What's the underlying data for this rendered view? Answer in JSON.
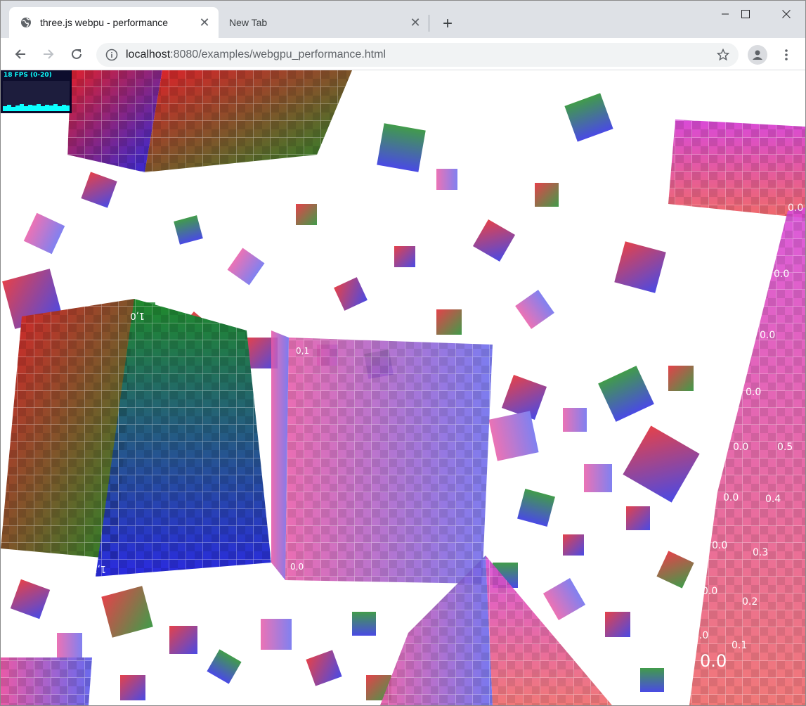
{
  "browser": {
    "tabs": [
      {
        "title": "three.js webpu - performance",
        "active": true
      },
      {
        "title": "New Tab",
        "active": false
      }
    ],
    "address": {
      "host": "localhost",
      "path": ":8080/examples/webgpu_performance.html"
    }
  },
  "stats": {
    "label": "18 FPS (0-20)"
  },
  "colors": {
    "accent_red": "#e0202a",
    "accent_green": "#1f8a2a",
    "accent_blue": "#2a2ae0",
    "accent_pink": "#e85aa8",
    "stats_text": "#00ffff"
  },
  "icons": [
    "globe-icon",
    "close-icon",
    "plus-icon",
    "back-arrow-icon",
    "forward-arrow-icon",
    "reload-icon",
    "info-icon",
    "star-icon",
    "profile-icon",
    "kebab-menu-icon",
    "minimize-icon",
    "maximize-icon",
    "window-close-icon"
  ]
}
